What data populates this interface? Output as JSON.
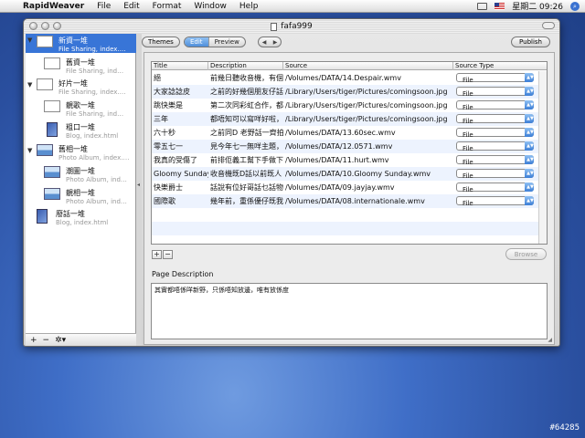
{
  "menubar": {
    "apple": "",
    "items": [
      "RapidWeaver",
      "File",
      "Edit",
      "Format",
      "Window",
      "Help"
    ],
    "clock": "星期二 09:26"
  },
  "window": {
    "title": "fafa999"
  },
  "sidebar": {
    "pages": [
      {
        "name": "新資一堆",
        "type": "File Sharing, index.…",
        "kind": "file",
        "selected": true,
        "disclosure": "▼"
      },
      {
        "name": "舊資一堆",
        "type": "File Sharing, ind…",
        "kind": "file",
        "selected": false,
        "disclosure": ""
      },
      {
        "name": "好片一堆",
        "type": "File Sharing, index.…",
        "kind": "file",
        "selected": false,
        "disclosure": "▼"
      },
      {
        "name": "靚歌一堆",
        "type": "File Sharing, ind…",
        "kind": "file",
        "selected": false,
        "disclosure": ""
      },
      {
        "name": "粗口一堆",
        "type": "Blog, index.html",
        "kind": "blog",
        "selected": false,
        "disclosure": ""
      },
      {
        "name": "舊相一堆",
        "type": "Photo Album, index.…",
        "kind": "photo",
        "selected": false,
        "disclosure": "▼"
      },
      {
        "name": "潮圖一堆",
        "type": "Photo Album, ind…",
        "kind": "photo",
        "selected": false,
        "disclosure": ""
      },
      {
        "name": "靚相一堆",
        "type": "Photo Album, ind…",
        "kind": "photo",
        "selected": false,
        "disclosure": ""
      },
      {
        "name": "廢話一堆",
        "type": "Blog, index.html",
        "kind": "blog",
        "selected": false,
        "disclosure": ""
      }
    ],
    "footer": {
      "add": "+",
      "remove": "−",
      "action": "✲▾"
    }
  },
  "toolbar": {
    "themes": "Themes",
    "edit": "Edit",
    "preview": "Preview",
    "back": "◀",
    "forward": "▶",
    "publish": "Publish"
  },
  "table": {
    "headers": [
      "Title",
      "Description",
      "Source",
      "Source Type"
    ],
    "rows": [
      {
        "title": "絕",
        "desc": "前幾日聽收音機，有個",
        "src": "/Volumes/DATA/14.Despair.wmv",
        "type": "File"
      },
      {
        "title": "大家諗諗皮",
        "desc": "之前的好幾個朋友仔話",
        "src": "/Library/Users/tiger/Pictures/comingsoon.jpg",
        "type": "File"
      },
      {
        "title": "跳快樂是",
        "desc": "第二次同彩虹合作，都",
        "src": "/Library/Users/tiger/Pictures/comingsoon.jpg",
        "type": "File"
      },
      {
        "title": "三年",
        "desc": "都唔知可以寫咩好啦，",
        "src": "/Library/Users/tiger/Pictures/comingsoon.jpg",
        "type": "File"
      },
      {
        "title": "六十秒",
        "desc": "之前同D 老野話一齊拍",
        "src": "/Volumes/DATA/13.60sec.wmv",
        "type": "File"
      },
      {
        "title": "零五七一",
        "desc": "見今年七一無咩主題，",
        "src": "/Volumes/DATA/12.0571.wmv",
        "type": "File"
      },
      {
        "title": "我真的受傷了",
        "desc": "前排佢義工幫下手做下",
        "src": "/Volumes/DATA/11.hurt.wmv",
        "type": "File"
      },
      {
        "title": "Gloomy Sunday",
        "desc": "收音機既D話以前既人",
        "src": "/Volumes/DATA/10.Gloomy Sunday.wmv",
        "type": "File"
      },
      {
        "title": "快樂爵士",
        "desc": "話說有位好哥話乜話物",
        "src": "/Volumes/DATA/09.jayjay.wmv",
        "type": "File"
      },
      {
        "title": "國際歌",
        "desc": "幾年前，重係優仔既我",
        "src": "/Volumes/DATA/08.internationale.wmv",
        "type": "File"
      }
    ]
  },
  "controls": {
    "add": "+",
    "remove": "−",
    "browse": "Browse"
  },
  "description": {
    "label": "Page Description",
    "value": "其實都唔係咩新野，只係唔知放邊，唯有放係度"
  },
  "watermark": "#64285"
}
